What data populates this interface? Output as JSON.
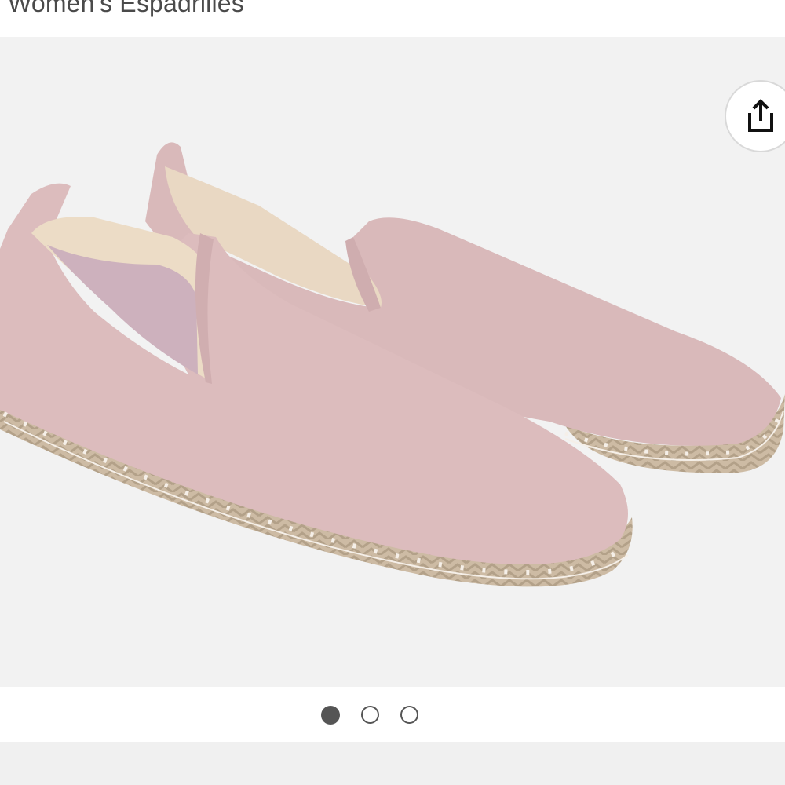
{
  "product": {
    "title": "Women's Espadrilles"
  },
  "gallery": {
    "image_subject": "pink-suede-espadrilles",
    "current_index": 1,
    "total_images": 3,
    "share_icon": "share-icon"
  },
  "colors": {
    "title_text": "#4a4a4a",
    "image_background": "#f2f2f2",
    "dot_active": "#555555",
    "shoe_pink": "#dcbcbd",
    "jute_sole": "#cdbba4"
  }
}
